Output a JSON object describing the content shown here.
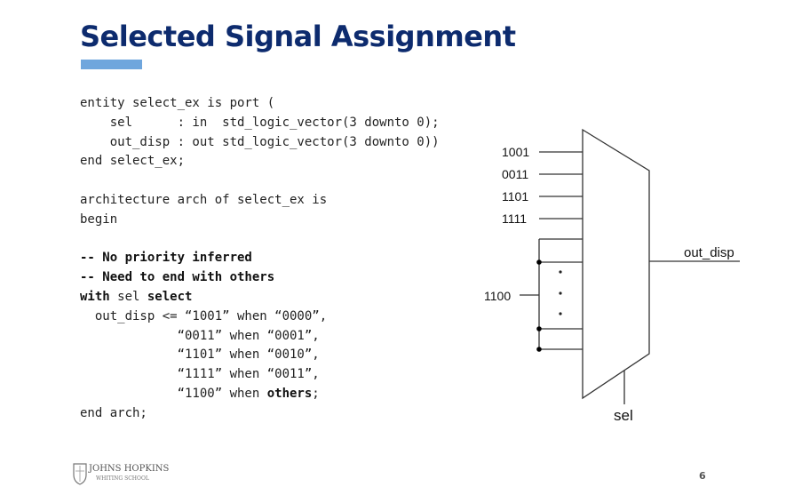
{
  "slide": {
    "title": "Selected Signal Assignment",
    "page_number": "6"
  },
  "code": {
    "lines": [
      [
        {
          "t": "entity select_ex is port (",
          "b": false
        }
      ],
      [
        {
          "t": "    sel      : in  std_logic_vector(3 downto 0);",
          "b": false
        }
      ],
      [
        {
          "t": "    out_disp : out std_logic_vector(3 downto 0))",
          "b": false
        }
      ],
      [
        {
          "t": "end select_ex;",
          "b": false
        }
      ],
      [
        {
          "t": "",
          "b": false
        }
      ],
      [
        {
          "t": "architecture arch of select_ex is",
          "b": false
        }
      ],
      [
        {
          "t": "begin",
          "b": false
        }
      ],
      [
        {
          "t": "",
          "b": false
        }
      ],
      [
        {
          "t": "-- No priority inferred",
          "b": true
        }
      ],
      [
        {
          "t": "-- Need to end with others",
          "b": true
        }
      ],
      [
        {
          "t": "with",
          "b": true
        },
        {
          "t": " sel ",
          "b": false
        },
        {
          "t": "select",
          "b": true
        }
      ],
      [
        {
          "t": "  out_disp <= “1001” when “0000”,",
          "b": false
        }
      ],
      [
        {
          "t": "             “0011” when “0001”,",
          "b": false
        }
      ],
      [
        {
          "t": "             “1101” when “0010”,",
          "b": false
        }
      ],
      [
        {
          "t": "             “1111” when “0011”,",
          "b": false
        }
      ],
      [
        {
          "t": "             “1100” when ",
          "b": false
        },
        {
          "t": "others",
          "b": true
        },
        {
          "t": ";",
          "b": false
        }
      ],
      [
        {
          "t": "end arch;",
          "b": false
        }
      ]
    ]
  },
  "diagram": {
    "inputs": [
      "1001",
      "0011",
      "1101",
      "1111"
    ],
    "default_input": "1100",
    "output_label": "out_disp",
    "select_label": "sel",
    "ellipsis": "·"
  },
  "footer": {
    "logo_line_1": "JOHNS HOPKINS",
    "logo_line_2": "WHITING SCHOOL",
    "logo_icon": "jhu-shield-icon"
  },
  "colors": {
    "title": "#0d2b6e",
    "accent_bar": "#6fa6dd",
    "text": "#222222",
    "diagram_line": "#333333"
  }
}
